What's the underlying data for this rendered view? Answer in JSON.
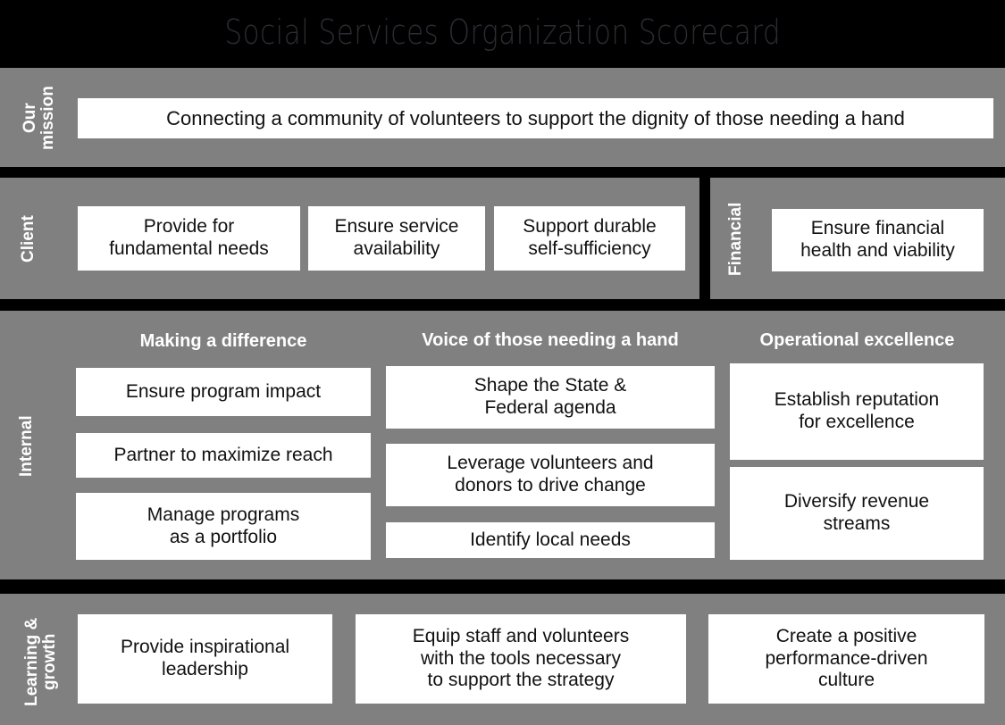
{
  "header": {
    "title": "Social Services Organization Scorecard",
    "title_color": "#2b2b33",
    "background": "#000000"
  },
  "theme": {
    "panel_gray": "#808080",
    "box_white": "#ffffff",
    "divider_black": "#000000",
    "label_white": "#ffffff",
    "box_text": "#111111"
  },
  "perspectives": {
    "mission": {
      "label": "Our\nmission",
      "objectives": [
        {
          "text": "Connecting a community of volunteers to support the dignity of those needing a hand"
        }
      ]
    },
    "client": {
      "label": "Client",
      "objectives": [
        {
          "text": "Provide for\nfundamental needs"
        },
        {
          "text": "Ensure service\navailability"
        },
        {
          "text": "Support durable\nself-sufficiency"
        }
      ]
    },
    "financial": {
      "label": "Financial",
      "objectives": [
        {
          "text": "Ensure financial\nhealth and viability"
        }
      ]
    },
    "internal": {
      "label": "Internal",
      "columns": [
        {
          "header": "Making a difference",
          "objectives": [
            {
              "text": "Ensure program impact"
            },
            {
              "text": "Partner to maximize reach"
            },
            {
              "text": "Manage programs\nas a portfolio"
            }
          ]
        },
        {
          "header": "Voice of those needing a hand",
          "objectives": [
            {
              "text": "Shape the State &\nFederal agenda"
            },
            {
              "text": "Leverage volunteers and\ndonors to drive change"
            },
            {
              "text": "Identify local needs"
            }
          ]
        },
        {
          "header": "Operational excellence",
          "objectives": [
            {
              "text": "Establish reputation\nfor excellence"
            },
            {
              "text": "Diversify revenue\nstreams"
            }
          ]
        }
      ]
    },
    "learning": {
      "label": "Learning &\ngrowth",
      "objectives": [
        {
          "text": "Provide inspirational\nleadership"
        },
        {
          "text": "Equip staff and volunteers\nwith the tools necessary\nto support the strategy"
        },
        {
          "text": "Create a positive\nperformance-driven\nculture"
        }
      ]
    }
  }
}
